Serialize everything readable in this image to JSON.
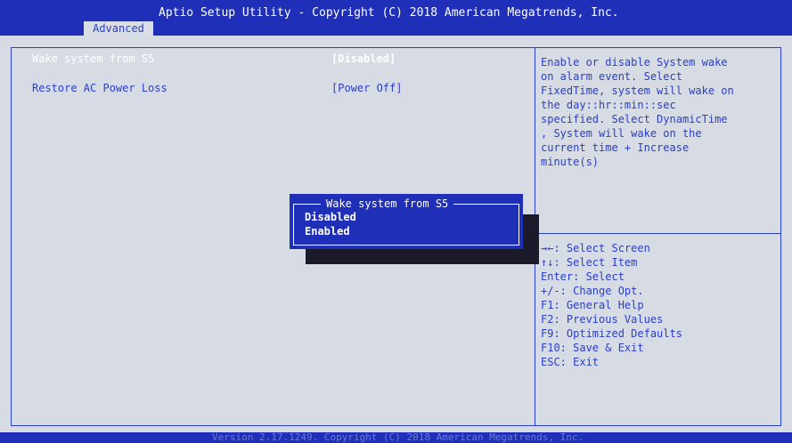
{
  "header": {
    "title": "Aptio Setup Utility - Copyright (C) 2018 American Megatrends, Inc.",
    "active_tab": "Advanced"
  },
  "settings": [
    {
      "label": "Wake system from S5",
      "value": "[Disabled]",
      "selected": true
    },
    {
      "label": "Restore AC Power Loss",
      "value": "[Power Off]",
      "selected": false
    }
  ],
  "help": {
    "lines": [
      "Enable or disable System wake",
      "on alarm event. Select",
      "FixedTime, system will wake on",
      "the day::hr::min::sec",
      "specified. Select DynamicTime",
      ", System will wake on the",
      "current time + Increase",
      "minute(s)"
    ]
  },
  "keys": [
    "→←: Select Screen",
    "↑↓: Select Item",
    "Enter: Select",
    "+/-: Change Opt.",
    "F1: General Help",
    "F2: Previous Values",
    "F9: Optimized Defaults",
    "F10: Save & Exit",
    "ESC: Exit"
  ],
  "popup": {
    "title": "Wake system from S5",
    "options": [
      "Disabled",
      "Enabled"
    ],
    "highlighted": "Disabled"
  },
  "footer": "Version 2.17.1249. Copyright (C) 2018 American Megatrends, Inc.",
  "colors": {
    "bar_blue": "#1f2fb8",
    "text_blue": "#2a3fc8",
    "background": "#d7dbe3"
  }
}
